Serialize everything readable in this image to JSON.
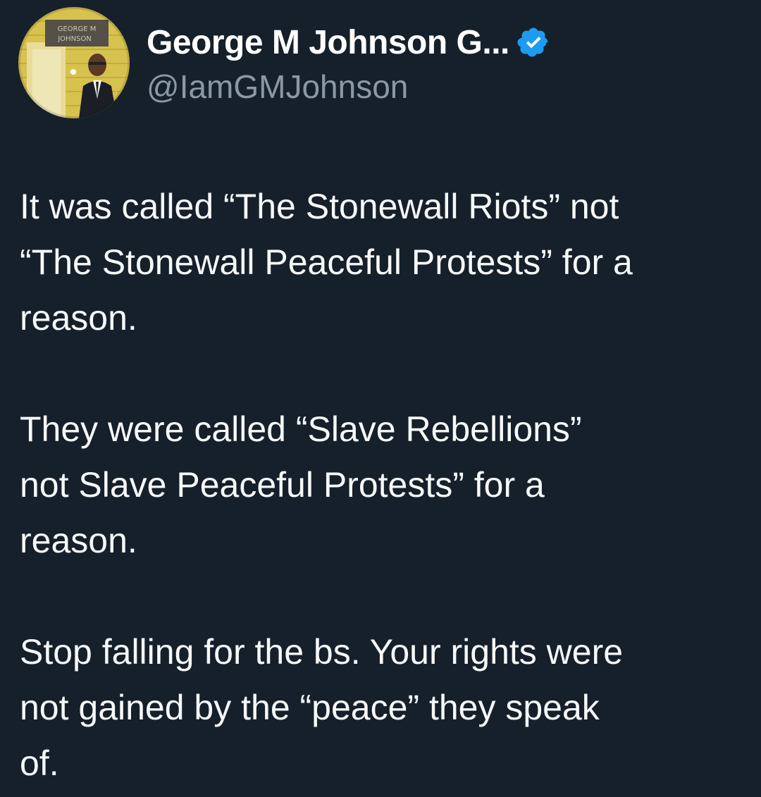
{
  "author": {
    "display_name": "George M Johnson G...",
    "handle": "@IamGMJohnson",
    "verified": true,
    "avatar": {
      "sign_text_line1": "GEORGE M",
      "sign_text_line2": "JOHNSON"
    }
  },
  "tweet": {
    "paragraphs": [
      "It was called “The Stonewall Riots” not\n“The Stonewall Peaceful Protests” for a\nreason.",
      "They were  called “Slave Rebellions”\nnot Slave Peaceful Protests” for a\nreason.",
      "Stop falling for the bs. Your rights were\nnot gained by the “peace” they speak\nof."
    ]
  },
  "colors": {
    "background": "#16202b",
    "text": "#f7f9f9",
    "secondary_text": "#8b98a5",
    "verified_badge": "#1d9bf0"
  },
  "icons": {
    "verified": "verified-badge-icon"
  }
}
